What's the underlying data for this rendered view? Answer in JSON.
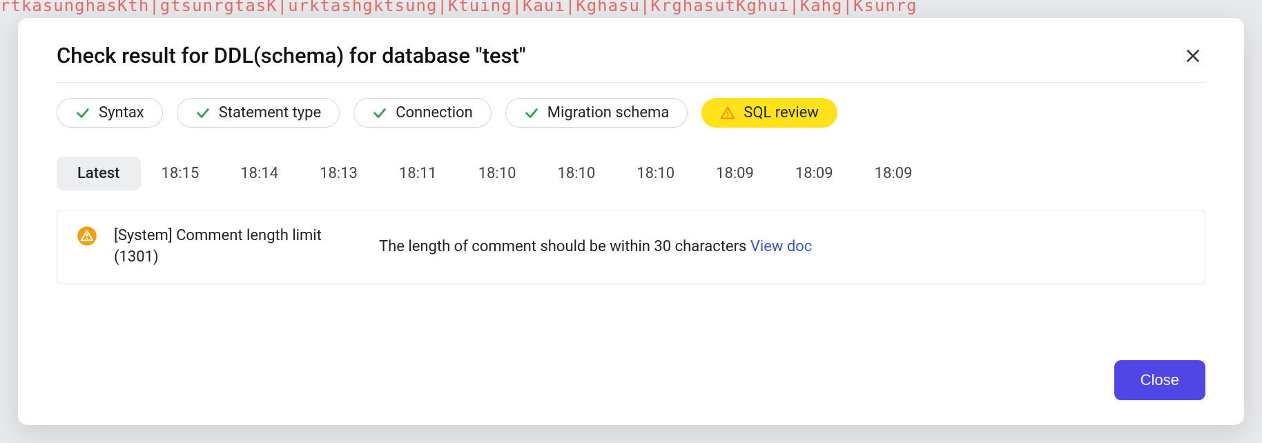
{
  "modal": {
    "title": "Check result for DDL(schema) for database \"test\""
  },
  "pills": {
    "syntax": "Syntax",
    "statement_type": "Statement type",
    "connection": "Connection",
    "migration_schema": "Migration schema",
    "sql_review": "SQL review"
  },
  "tabs": {
    "latest": "Latest",
    "t0": "18:15",
    "t1": "18:14",
    "t2": "18:13",
    "t3": "18:11",
    "t4": "18:10",
    "t5": "18:10",
    "t6": "18:10",
    "t7": "18:09",
    "t8": "18:09",
    "t9": "18:09"
  },
  "issue": {
    "title": "[System] Comment length limit (1301)",
    "desc": "The length of comment should be within 30 characters ",
    "doc_link": "View doc"
  },
  "footer": {
    "close": "Close"
  }
}
